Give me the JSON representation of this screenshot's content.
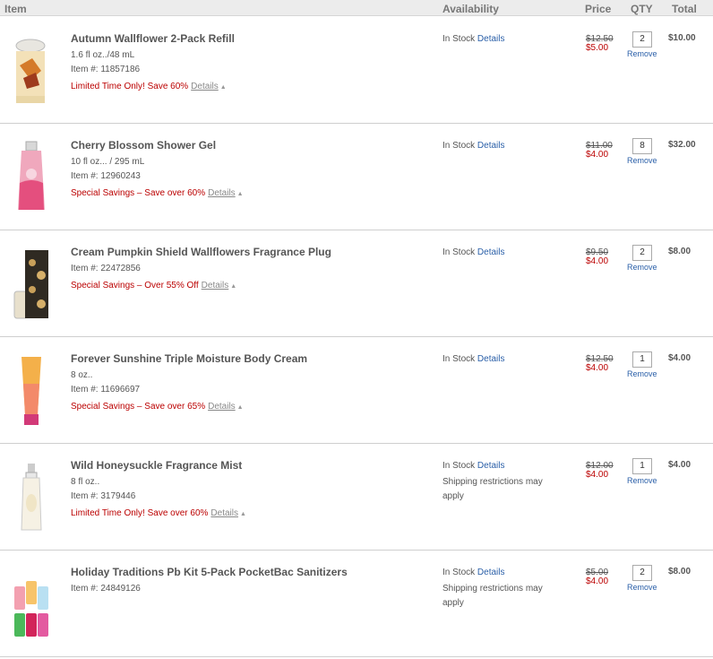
{
  "header": {
    "item": "Item",
    "availability": "Availability",
    "price": "Price",
    "qty": "QTY",
    "total": "Total"
  },
  "labels": {
    "in_stock": "In Stock",
    "details": "Details",
    "remove": "Remove",
    "shipping_restriction": "Shipping restrictions may apply"
  },
  "items": [
    {
      "name": "Autumn Wallflower 2-Pack Refill",
      "size": "1.6 fl oz../48 mL",
      "item_no": "Item #: 11857186",
      "promo": "Limited Time Only! Save 60%",
      "old_price": "$12.50",
      "new_price": "$5.00",
      "qty": "2",
      "total": "$10.00",
      "image": "wallflower-refill-image"
    },
    {
      "name": "Cherry Blossom Shower Gel",
      "size": "10 fl oz... / 295 mL",
      "item_no": "Item #: 12960243",
      "promo": "Special Savings – Save over 60%",
      "old_price": "$11.00",
      "new_price": "$4.00",
      "qty": "8",
      "total": "$32.00",
      "image": "shower-gel-bottle-image"
    },
    {
      "name": "Cream Pumpkin Shield Wallflowers Fragrance Plug",
      "item_no": "Item #: 22472856",
      "promo": "Special Savings – Over 55% Off",
      "old_price": "$9.50",
      "new_price": "$4.00",
      "qty": "2",
      "total": "$8.00",
      "image": "fragrance-plug-image"
    },
    {
      "name": "Forever Sunshine Triple Moisture Body Cream",
      "size": "8 oz..",
      "item_no": "Item #: 11696697",
      "promo": "Special Savings – Save over 65%",
      "old_price": "$12.50",
      "new_price": "$4.00",
      "qty": "1",
      "total": "$4.00",
      "image": "body-cream-tube-image"
    },
    {
      "name": "Wild Honeysuckle Fragrance Mist",
      "size": "8 fl oz..",
      "item_no": "Item #: 3179446",
      "promo": "Limited Time Only! Save over 60%",
      "old_price": "$12.00",
      "new_price": "$4.00",
      "qty": "1",
      "total": "$4.00",
      "image": "fragrance-mist-bottle-image"
    },
    {
      "name": "Holiday Traditions Pb Kit 5-Pack PocketBac Sanitizers",
      "item_no": "Item #: 24849126",
      "old_price": "$5.00",
      "new_price": "$4.00",
      "qty": "2",
      "total": "$8.00",
      "image": "pocketbac-sanitizers-image"
    }
  ]
}
